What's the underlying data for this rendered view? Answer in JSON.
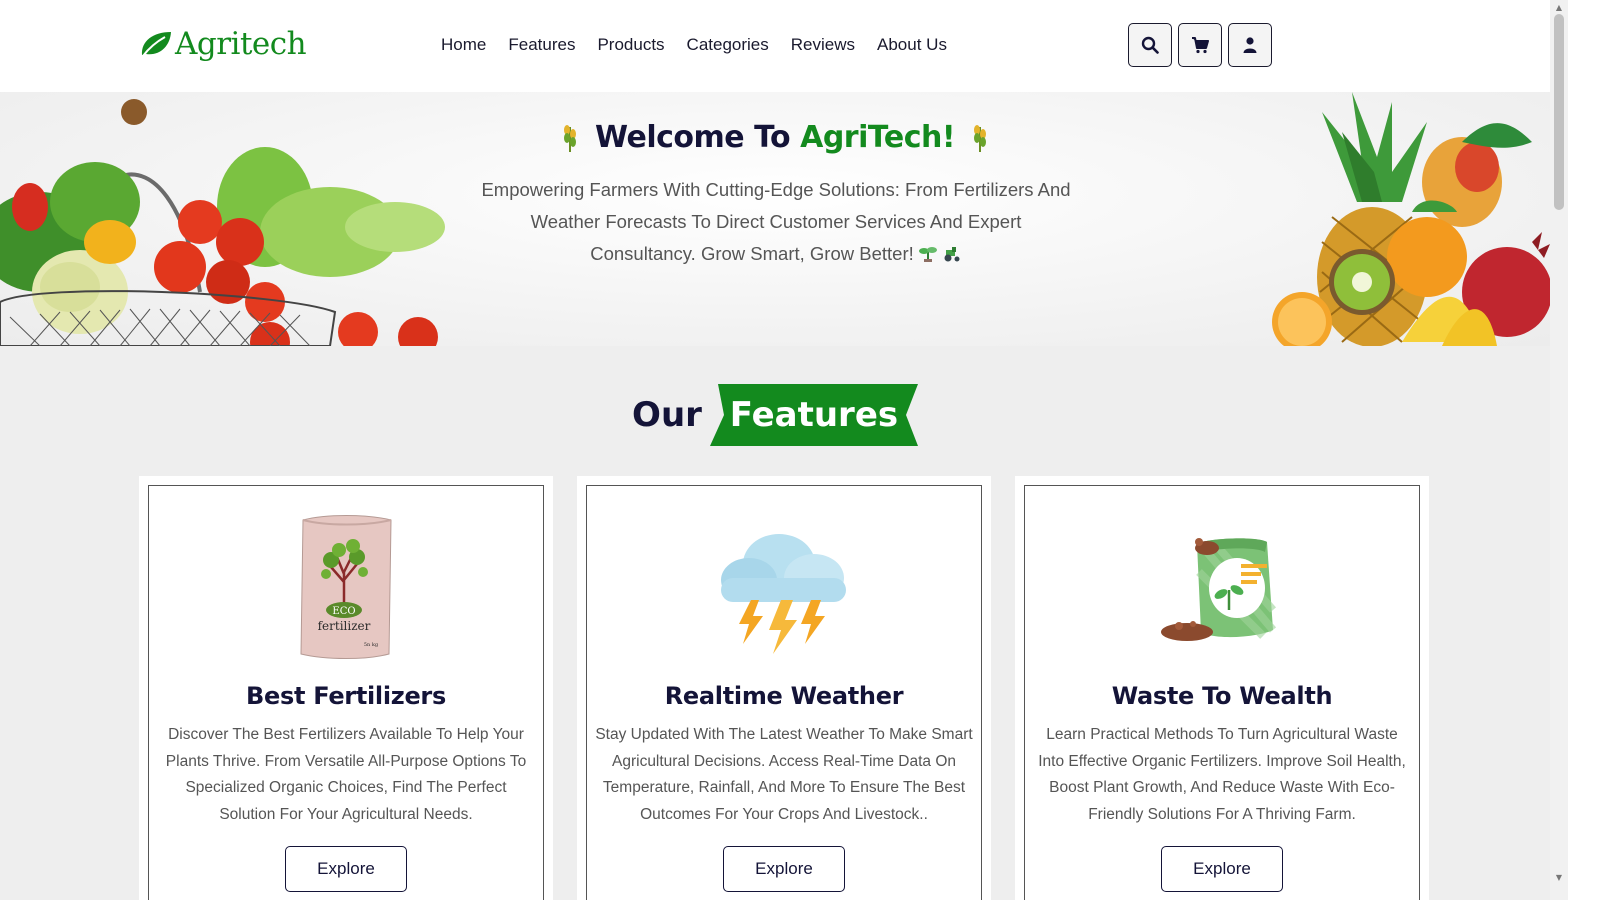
{
  "brand": {
    "name": "Agritech"
  },
  "nav": {
    "items": [
      "Home",
      "Features",
      "Products",
      "Categories",
      "Reviews",
      "About Us"
    ]
  },
  "header_icons": [
    "search-icon",
    "cart-icon",
    "user-icon"
  ],
  "hero": {
    "title_prefix": "Welcome To ",
    "title_highlight": "AgriTech!",
    "subtitle": "Empowering Farmers With Cutting-Edge Solutions: From Fertilizers And Weather Forecasts To Direct Customer Services And Expert Consultancy. Grow Smart, Grow Better!"
  },
  "features": {
    "heading_prefix": "Our",
    "heading_highlight": "Features",
    "cards": [
      {
        "title": "Best Fertilizers",
        "description": "Discover The Best Fertilizers Available To Help Your Plants Thrive. From Versatile All-Purpose Options To Specialized Organic Choices, Find The Perfect Solution For Your Agricultural Needs.",
        "button": "Explore",
        "image_text": {
          "badge": "ECO",
          "label": "fertilizer",
          "weight": "5n kg"
        }
      },
      {
        "title": "Realtime Weather",
        "description": "Stay Updated With The Latest Weather To Make Smart Agricultural Decisions. Access Real-Time Data On Temperature, Rainfall, And More To Ensure The Best Outcomes For Your Crops And Livestock..",
        "button": "Explore"
      },
      {
        "title": "Waste To Wealth",
        "description": "Learn Practical Methods To Turn Agricultural Waste Into Effective Organic Fertilizers. Improve Soil Health, Boost Plant Growth, And Reduce Waste With Eco-Friendly Solutions For A Thriving Farm.",
        "button": "Explore"
      }
    ]
  },
  "colors": {
    "brand_green": "#138a1e",
    "dark_navy": "#141438",
    "body_text": "#555555",
    "page_bg": "#eeeeee"
  }
}
